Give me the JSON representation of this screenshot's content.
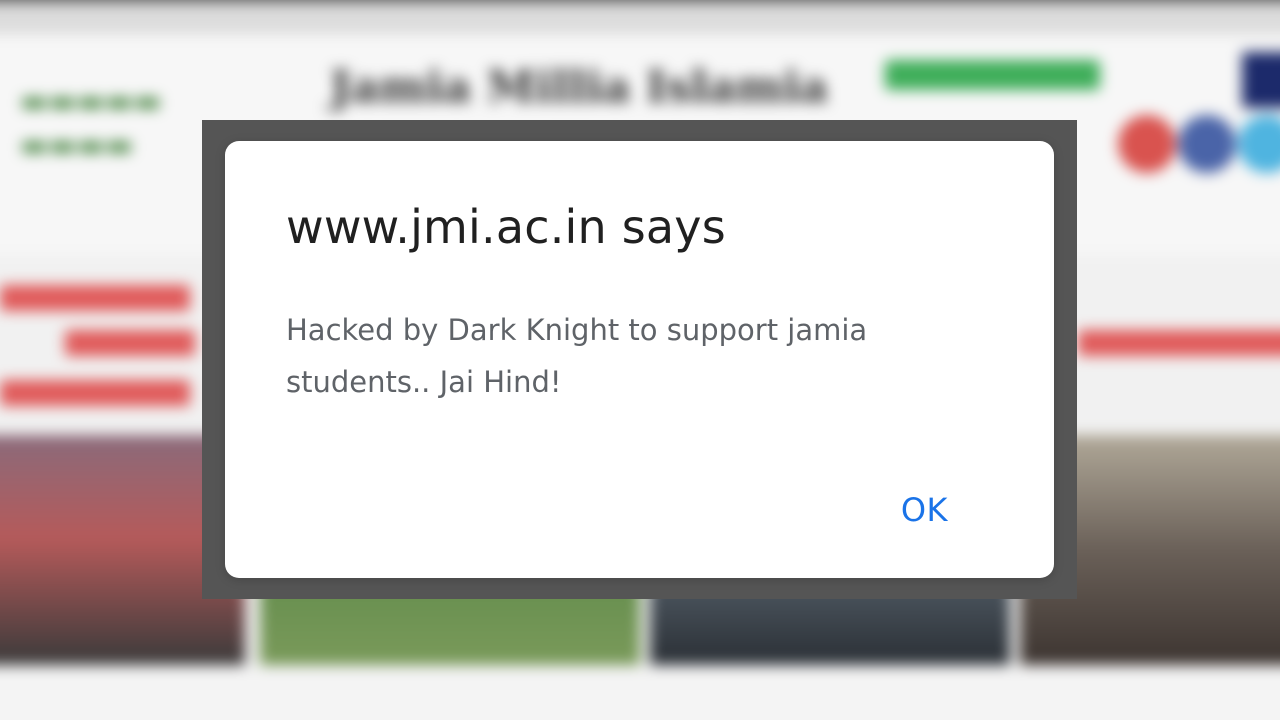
{
  "dialog": {
    "origin_title": "www.jmi.ac.in says",
    "message": "Hacked by Dark Knight to support jamia students.. Jai Hind!",
    "ok_label": "OK"
  },
  "background_page": {
    "site_title": "Jamia Millia Islamia"
  },
  "colors": {
    "dialog_background": "#ffffff",
    "title_text": "#202020",
    "message_text": "#5f6368",
    "ok_button_text": "#1a73e8",
    "frame": "#555555"
  }
}
